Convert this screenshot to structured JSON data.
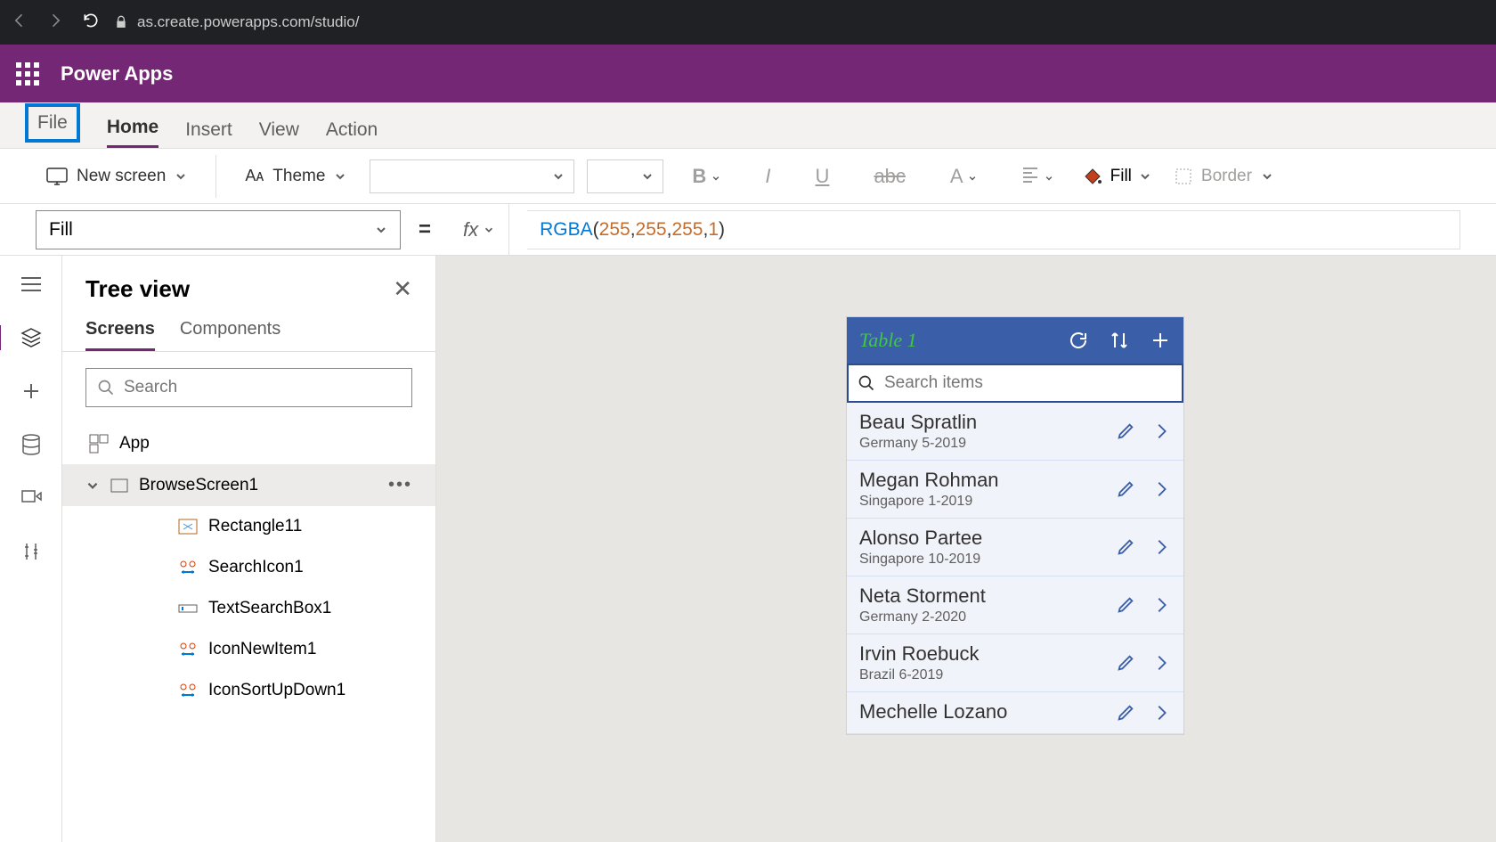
{
  "browser": {
    "url": "as.create.powerapps.com/studio/"
  },
  "header": {
    "app_name": "Power Apps"
  },
  "menu": {
    "tabs": [
      "File",
      "Home",
      "Insert",
      "View",
      "Action"
    ],
    "active": "Home",
    "highlighted": "File"
  },
  "toolbar": {
    "new_screen": "New screen",
    "theme": "Theme",
    "fill": "Fill",
    "border": "Border"
  },
  "formula": {
    "property": "Fill",
    "fx": "fx",
    "func": "RGBA",
    "args": [
      "255",
      "255",
      "255",
      "1"
    ]
  },
  "tree": {
    "title": "Tree view",
    "tabs": [
      "Screens",
      "Components"
    ],
    "active_tab": "Screens",
    "search_placeholder": "Search",
    "app_label": "App",
    "items": [
      {
        "name": "BrowseScreen1",
        "selected": true
      },
      {
        "name": "Rectangle11"
      },
      {
        "name": "SearchIcon1"
      },
      {
        "name": "TextSearchBox1"
      },
      {
        "name": "IconNewItem1"
      },
      {
        "name": "IconSortUpDown1"
      }
    ]
  },
  "app_preview": {
    "title": "Table 1",
    "search_placeholder": "Search items",
    "records": [
      {
        "name": "Beau Spratlin",
        "sub": "Germany 5-2019"
      },
      {
        "name": "Megan Rohman",
        "sub": "Singapore 1-2019"
      },
      {
        "name": "Alonso Partee",
        "sub": "Singapore 10-2019"
      },
      {
        "name": "Neta Storment",
        "sub": "Germany 2-2020"
      },
      {
        "name": "Irvin Roebuck",
        "sub": "Brazil 6-2019"
      },
      {
        "name": "Mechelle Lozano",
        "sub": ""
      }
    ]
  }
}
